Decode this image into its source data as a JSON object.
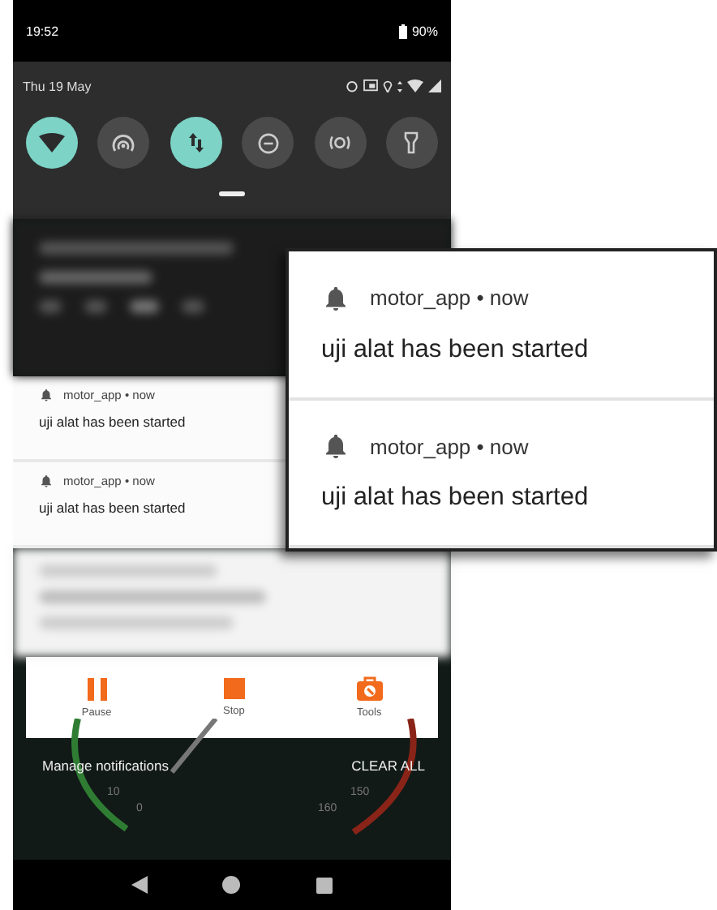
{
  "status_bar": {
    "time": "19:52",
    "battery": "90%"
  },
  "quick_settings": {
    "date": "Thu 19 May",
    "status_icons": [
      {
        "kind": "alarm"
      },
      {
        "kind": "cast"
      },
      {
        "kind": "location"
      },
      {
        "kind": "data"
      },
      {
        "kind": "wifi"
      },
      {
        "kind": "signal"
      }
    ],
    "tiles": [
      {
        "kind": "wifi",
        "on": true
      },
      {
        "kind": "hotspot",
        "on": false
      },
      {
        "kind": "data",
        "on": true
      },
      {
        "kind": "dnd",
        "on": false
      },
      {
        "kind": "vibrate",
        "on": false
      },
      {
        "kind": "flashlight",
        "on": false
      }
    ]
  },
  "notifications": [
    {
      "source": "motor_app • now",
      "text": "uji alat has been started"
    },
    {
      "source": "motor_app • now",
      "text": "uji alat has been started"
    }
  ],
  "media_actions": [
    {
      "kind": "pause",
      "label": "Pause"
    },
    {
      "kind": "stop",
      "label": "Stop"
    },
    {
      "kind": "tools",
      "label": "Tools"
    }
  ],
  "footer": {
    "manage": "Manage notifications",
    "clear": "CLEAR ALL"
  },
  "gauges": {
    "left_labels": [
      "10",
      "0"
    ],
    "right_labels": [
      "150",
      "160"
    ]
  },
  "zoomed_notifications": [
    {
      "source": "motor_app • now",
      "text": "uji alat has been started"
    },
    {
      "source": "motor_app • now",
      "text": "uji alat has been started"
    }
  ]
}
